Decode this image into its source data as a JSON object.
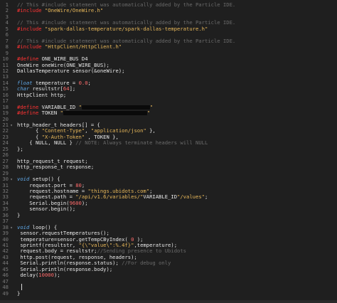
{
  "editor": {
    "lines": [
      {
        "n": "1",
        "fold": "",
        "tokens": [
          {
            "c": "cm",
            "t": "// This #include statement was automatically added by the Particle IDE."
          }
        ]
      },
      {
        "n": "2",
        "fold": "",
        "tokens": [
          {
            "c": "pp",
            "t": "#include "
          },
          {
            "c": "str",
            "t": "\"OneWire/OneWire.h\""
          }
        ]
      },
      {
        "n": "3",
        "fold": "",
        "tokens": []
      },
      {
        "n": "4",
        "fold": "",
        "tokens": [
          {
            "c": "cm",
            "t": "// This #include statement was automatically added by the Particle IDE."
          }
        ]
      },
      {
        "n": "5",
        "fold": "",
        "tokens": [
          {
            "c": "pp",
            "t": "#include "
          },
          {
            "c": "str",
            "t": "\"spark-dallas-temperature/spark-dallas-temperature.h\""
          }
        ]
      },
      {
        "n": "6",
        "fold": "",
        "tokens": []
      },
      {
        "n": "7",
        "fold": "",
        "tokens": [
          {
            "c": "cm",
            "t": "// This #include statement was automatically added by the Particle IDE."
          }
        ]
      },
      {
        "n": "8",
        "fold": "",
        "tokens": [
          {
            "c": "pp",
            "t": "#include "
          },
          {
            "c": "str",
            "t": "\"HttpClient/HttpClient.h\""
          }
        ]
      },
      {
        "n": "9",
        "fold": "",
        "tokens": []
      },
      {
        "n": "10",
        "fold": "",
        "tokens": [
          {
            "c": "pp",
            "t": "#define "
          },
          {
            "c": "def",
            "t": "ONE_WIRE_BUS D4"
          }
        ]
      },
      {
        "n": "11",
        "fold": "",
        "tokens": [
          {
            "c": "fn",
            "t": "OneWire oneWire(ONE_WIRE_BUS);"
          }
        ]
      },
      {
        "n": "12",
        "fold": "",
        "tokens": [
          {
            "c": "fn",
            "t": "DallasTemperature sensor(&oneWire);"
          }
        ]
      },
      {
        "n": "13",
        "fold": "",
        "tokens": []
      },
      {
        "n": "14",
        "fold": "",
        "tokens": [
          {
            "c": "ty",
            "t": "float "
          },
          {
            "c": "fn",
            "t": "temperature = "
          },
          {
            "c": "num",
            "t": "0.0"
          },
          {
            "c": "fn",
            "t": ";"
          }
        ]
      },
      {
        "n": "15",
        "fold": "",
        "tokens": [
          {
            "c": "ty",
            "t": "char "
          },
          {
            "c": "fn",
            "t": "resultstr["
          },
          {
            "c": "num",
            "t": "64"
          },
          {
            "c": "fn",
            "t": "];"
          }
        ]
      },
      {
        "n": "16",
        "fold": "",
        "tokens": [
          {
            "c": "fn",
            "t": "HttpClient http;"
          }
        ]
      },
      {
        "n": "17",
        "fold": "",
        "tokens": []
      },
      {
        "n": "18",
        "fold": "",
        "tokens": [
          {
            "c": "pp",
            "t": "#define "
          },
          {
            "c": "def",
            "t": "VARIABLE_ID "
          },
          {
            "c": "str",
            "t": "\""
          },
          {
            "c": "redact",
            "w": 96
          },
          {
            "c": "str",
            "t": "\""
          }
        ]
      },
      {
        "n": "19",
        "fold": "",
        "tokens": [
          {
            "c": "pp",
            "t": "#define "
          },
          {
            "c": "def",
            "t": "TOKEN "
          },
          {
            "c": "str",
            "t": "\""
          },
          {
            "c": "redact",
            "w": 118
          },
          {
            "c": "str",
            "t": "\""
          }
        ]
      },
      {
        "n": "20",
        "fold": "",
        "tokens": []
      },
      {
        "n": "21",
        "fold": "▾",
        "tokens": [
          {
            "c": "fn",
            "t": "http_header_t headers[] = {"
          }
        ]
      },
      {
        "n": "22",
        "fold": "",
        "tokens": [
          {
            "c": "fn",
            "t": "      { "
          },
          {
            "c": "str",
            "t": "\"Content-Type\""
          },
          {
            "c": "fn",
            "t": ", "
          },
          {
            "c": "str",
            "t": "\"application/json\""
          },
          {
            "c": "fn",
            "t": " },"
          }
        ]
      },
      {
        "n": "23",
        "fold": "",
        "tokens": [
          {
            "c": "fn",
            "t": "      { "
          },
          {
            "c": "str",
            "t": "\"X-Auth-Token\""
          },
          {
            "c": "fn",
            "t": " , TOKEN },"
          }
        ]
      },
      {
        "n": "24",
        "fold": "",
        "tokens": [
          {
            "c": "fn",
            "t": "    { "
          },
          {
            "c": "lit",
            "t": "NULL"
          },
          {
            "c": "fn",
            "t": ", "
          },
          {
            "c": "lit",
            "t": "NULL"
          },
          {
            "c": "fn",
            "t": " } "
          },
          {
            "c": "cm",
            "t": "// NOTE: Always terminate headers will NULL"
          }
        ]
      },
      {
        "n": "25",
        "fold": "",
        "tokens": [
          {
            "c": "fn",
            "t": "};"
          }
        ]
      },
      {
        "n": "26",
        "fold": "",
        "tokens": []
      },
      {
        "n": "27",
        "fold": "",
        "tokens": [
          {
            "c": "fn",
            "t": "http_request_t request;"
          }
        ]
      },
      {
        "n": "28",
        "fold": "",
        "tokens": [
          {
            "c": "fn",
            "t": "http_response_t response;"
          }
        ]
      },
      {
        "n": "29",
        "fold": "",
        "tokens": []
      },
      {
        "n": "30",
        "fold": "▾",
        "tokens": [
          {
            "c": "kw",
            "t": "void "
          },
          {
            "c": "fn",
            "t": "setup() {"
          }
        ]
      },
      {
        "n": "31",
        "fold": "",
        "tokens": [
          {
            "c": "fn",
            "t": "    request.port = "
          },
          {
            "c": "num",
            "t": "80"
          },
          {
            "c": "fn",
            "t": ";"
          }
        ]
      },
      {
        "n": "32",
        "fold": "",
        "tokens": [
          {
            "c": "fn",
            "t": "    request.hostname = "
          },
          {
            "c": "str",
            "t": "\"things.ubidots.com\""
          },
          {
            "c": "fn",
            "t": ";"
          }
        ]
      },
      {
        "n": "33",
        "fold": "",
        "tokens": [
          {
            "c": "fn",
            "t": "    request.path = "
          },
          {
            "c": "str",
            "t": "\"/api/v1.6/variables/\""
          },
          {
            "c": "fn",
            "t": "VARIABLE_ID"
          },
          {
            "c": "str",
            "t": "\"/values\""
          },
          {
            "c": "fn",
            "t": ";"
          }
        ]
      },
      {
        "n": "34",
        "fold": "",
        "tokens": [
          {
            "c": "fn",
            "t": "    Serial.begin("
          },
          {
            "c": "num",
            "t": "9600"
          },
          {
            "c": "fn",
            "t": ");"
          }
        ]
      },
      {
        "n": "35",
        "fold": "",
        "tokens": [
          {
            "c": "fn",
            "t": "    sensor.begin();"
          }
        ]
      },
      {
        "n": "36",
        "fold": "",
        "tokens": [
          {
            "c": "fn",
            "t": "}"
          }
        ]
      },
      {
        "n": "37",
        "fold": "",
        "tokens": []
      },
      {
        "n": "38",
        "fold": "▾",
        "tokens": [
          {
            "c": "kw",
            "t": "void "
          },
          {
            "c": "fn",
            "t": "loop() {"
          }
        ]
      },
      {
        "n": "39",
        "fold": "",
        "tokens": [
          {
            "c": "fn",
            "t": " sensor.requestTemperatures();"
          }
        ]
      },
      {
        "n": "40",
        "fold": "",
        "tokens": [
          {
            "c": "fn",
            "t": " temperature=sensor.getTempCByIndex( "
          },
          {
            "c": "num",
            "t": "0"
          },
          {
            "c": "fn",
            "t": " );"
          }
        ]
      },
      {
        "n": "41",
        "fold": "",
        "tokens": [
          {
            "c": "fn",
            "t": " sprintf(resultstr, "
          },
          {
            "c": "str",
            "t": "\"{\\\"value\\\":%.4f}\""
          },
          {
            "c": "fn",
            "t": ",temperature);"
          }
        ]
      },
      {
        "n": "42",
        "fold": "",
        "tokens": [
          {
            "c": "fn",
            "t": " request.body = resultstr;"
          },
          {
            "c": "cm",
            "t": "//Sending presence to Ubidots"
          }
        ]
      },
      {
        "n": "43",
        "fold": "",
        "tokens": [
          {
            "c": "fn",
            "t": " http.post(request, response, headers);"
          }
        ]
      },
      {
        "n": "44",
        "fold": "",
        "tokens": [
          {
            "c": "fn",
            "t": " Serial.println(response.status); "
          },
          {
            "c": "cm",
            "t": "//For debug only"
          }
        ]
      },
      {
        "n": "45",
        "fold": "",
        "tokens": [
          {
            "c": "fn",
            "t": " Serial.println(response.body);"
          }
        ]
      },
      {
        "n": "46",
        "fold": "",
        "tokens": [
          {
            "c": "fn",
            "t": " delay("
          },
          {
            "c": "num",
            "t": "10000"
          },
          {
            "c": "fn",
            "t": ");"
          }
        ]
      },
      {
        "n": "47",
        "fold": "",
        "tokens": []
      },
      {
        "n": "48",
        "fold": "",
        "tokens": []
      },
      {
        "n": "49",
        "fold": "",
        "tokens": [
          {
            "c": "fn",
            "t": "}"
          }
        ]
      }
    ]
  }
}
